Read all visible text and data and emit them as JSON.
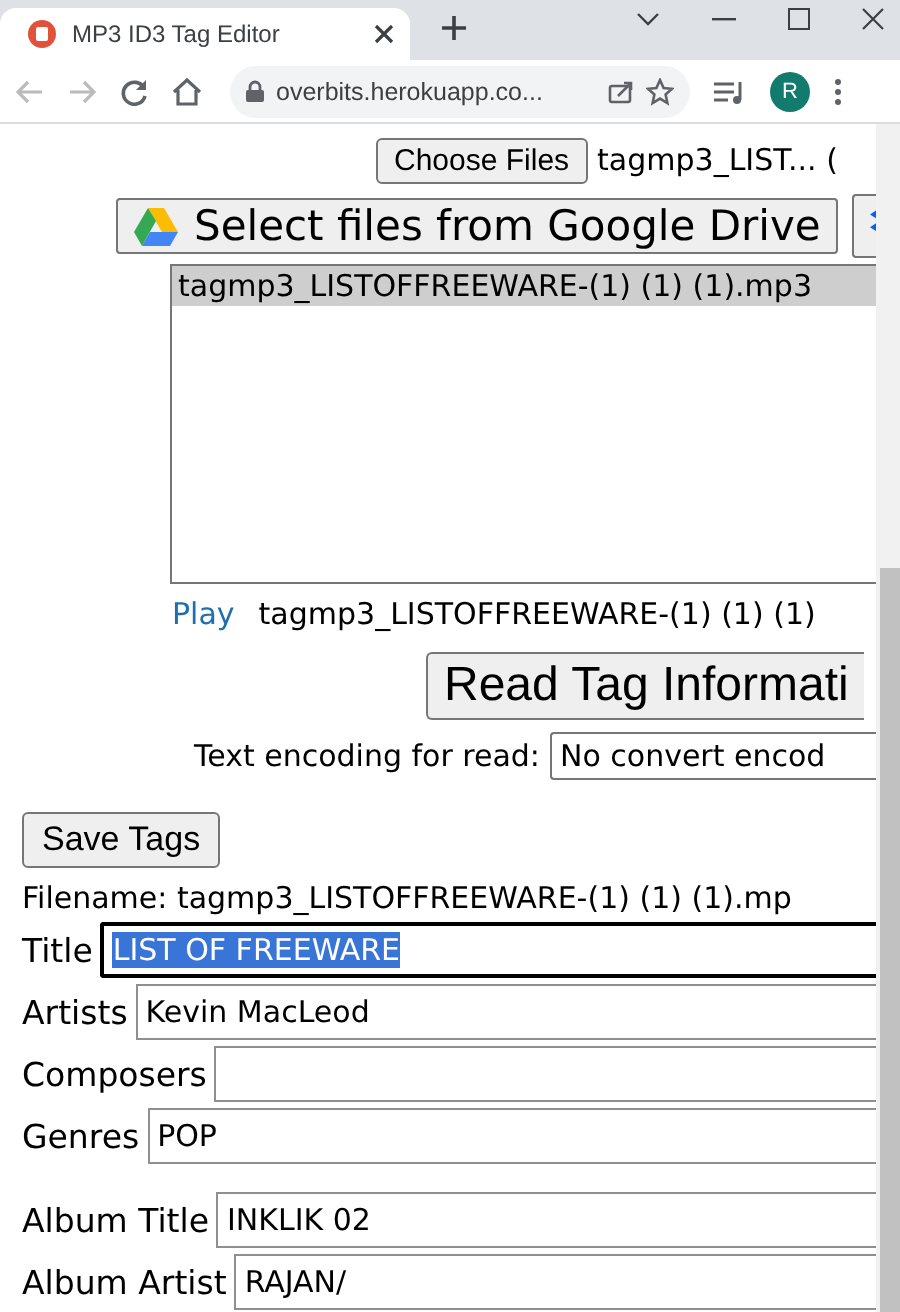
{
  "browser": {
    "tab_title": "MP3 ID3 Tag Editor",
    "address": "overbits.herokuapp.co...",
    "avatar": "R"
  },
  "file_input": {
    "button": "Choose Files",
    "file_text": "tagmp3_LIST... ("
  },
  "drive_button": "Select files from Google Drive",
  "file_list": [
    {
      "name": "tagmp3_LISTOFFREEWARE-(1) (1) (1).mp3",
      "selected": true
    }
  ],
  "player": {
    "play_link": "Play",
    "file": "tagmp3_LISTOFFREEWARE-(1) (1) (1)"
  },
  "read_button": "Read Tag Informati",
  "encoding": {
    "label": "Text encoding for read:",
    "value": "No convert encod"
  },
  "save_button": "Save Tags",
  "filename": "Filename: tagmp3_LISTOFFREEWARE-(1) (1) (1).mp",
  "fields": [
    {
      "label": "Title",
      "value": "LIST OF FREEWARE",
      "focused": true
    },
    {
      "label": "Artists",
      "value": "Kevin MacLeod",
      "focused": false
    },
    {
      "label": "Composers",
      "focused": false
    },
    {
      "label": "Genres",
      "value": "POP",
      "focused": false
    }
  ],
  "album_fields": [
    {
      "label": "Album Title",
      "value": "INKLIK 02",
      "focused": false
    },
    {
      "label": "Album Artist",
      "value": "RAJAN/",
      "focused": false
    }
  ]
}
